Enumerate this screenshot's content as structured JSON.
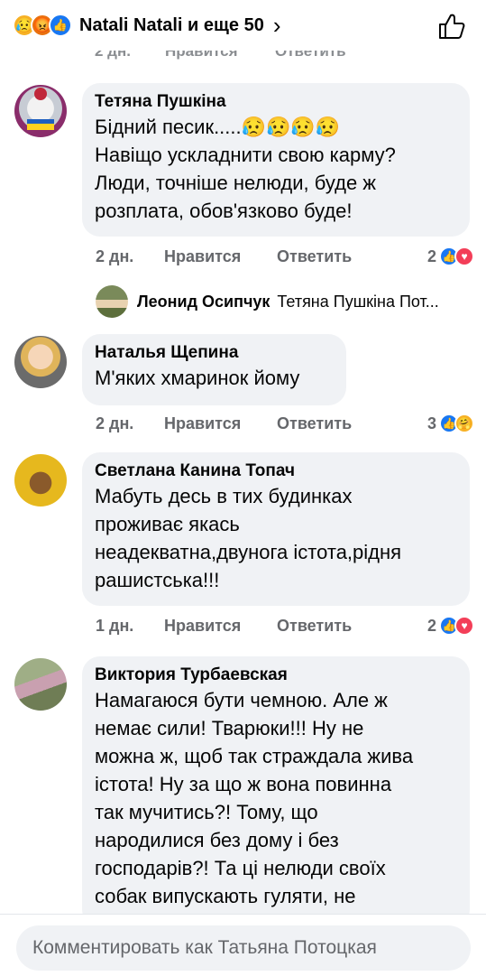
{
  "header": {
    "title": "Natali Natali и еще 50",
    "reaction_icons": [
      "sad-emoji",
      "angry-emoji",
      "like-icon"
    ],
    "chevron": "›"
  },
  "action_labels": {
    "like": "Нравится",
    "reply": "Ответить"
  },
  "comments": [
    {
      "author": "Тетяна Пушкіна",
      "text": "Бідний песик.....😥😥😥😥\nНавіщо ускладнити свою карму?\nЛюди, точніше нелюди, буде ж\nрозплата, обов'язково буде!",
      "time": "2 дн.",
      "reaction_count": "2",
      "reactions": [
        "like",
        "heart"
      ]
    },
    {
      "author": "Наталья Щепина",
      "text": "М'яких хмаринок йому",
      "time": "2 дн.",
      "reaction_count": "3",
      "reactions": [
        "like",
        "care"
      ]
    },
    {
      "author": "Светлана Канина Топач",
      "text": "Мабуть десь в тих будинках\nпроживає якась\nнеадекватна,двунога істота,рідня\nрашистська!!!",
      "time": "1 дн.",
      "reaction_count": "2",
      "reactions": [
        "like",
        "heart"
      ]
    },
    {
      "author": "Виктория Турбаевская",
      "text": "Намагаюся бути чемною. Але ж\nнемає сили! Тварюки!!! Ну не\nможна ж, щоб так страждала жива\nістота! Ну за що ж вона повинна\nтак мучитись?! Тому, що\nнародилися без дому і без\nгосподарів?! Та ці нелюди своїх\nсобак випускають гуляти, не"
    }
  ],
  "reply_preview": {
    "author": "Леонид Осипчук",
    "text": "Тетяна Пушкіна Пот..."
  },
  "composer": {
    "placeholder": "Комментировать как Татьяна Потоцкая"
  },
  "colors": {
    "like_blue": "#1877f2",
    "heart_red": "#f33e58",
    "bubble_bg": "#f0f2f5",
    "meta_gray": "#65676b"
  }
}
